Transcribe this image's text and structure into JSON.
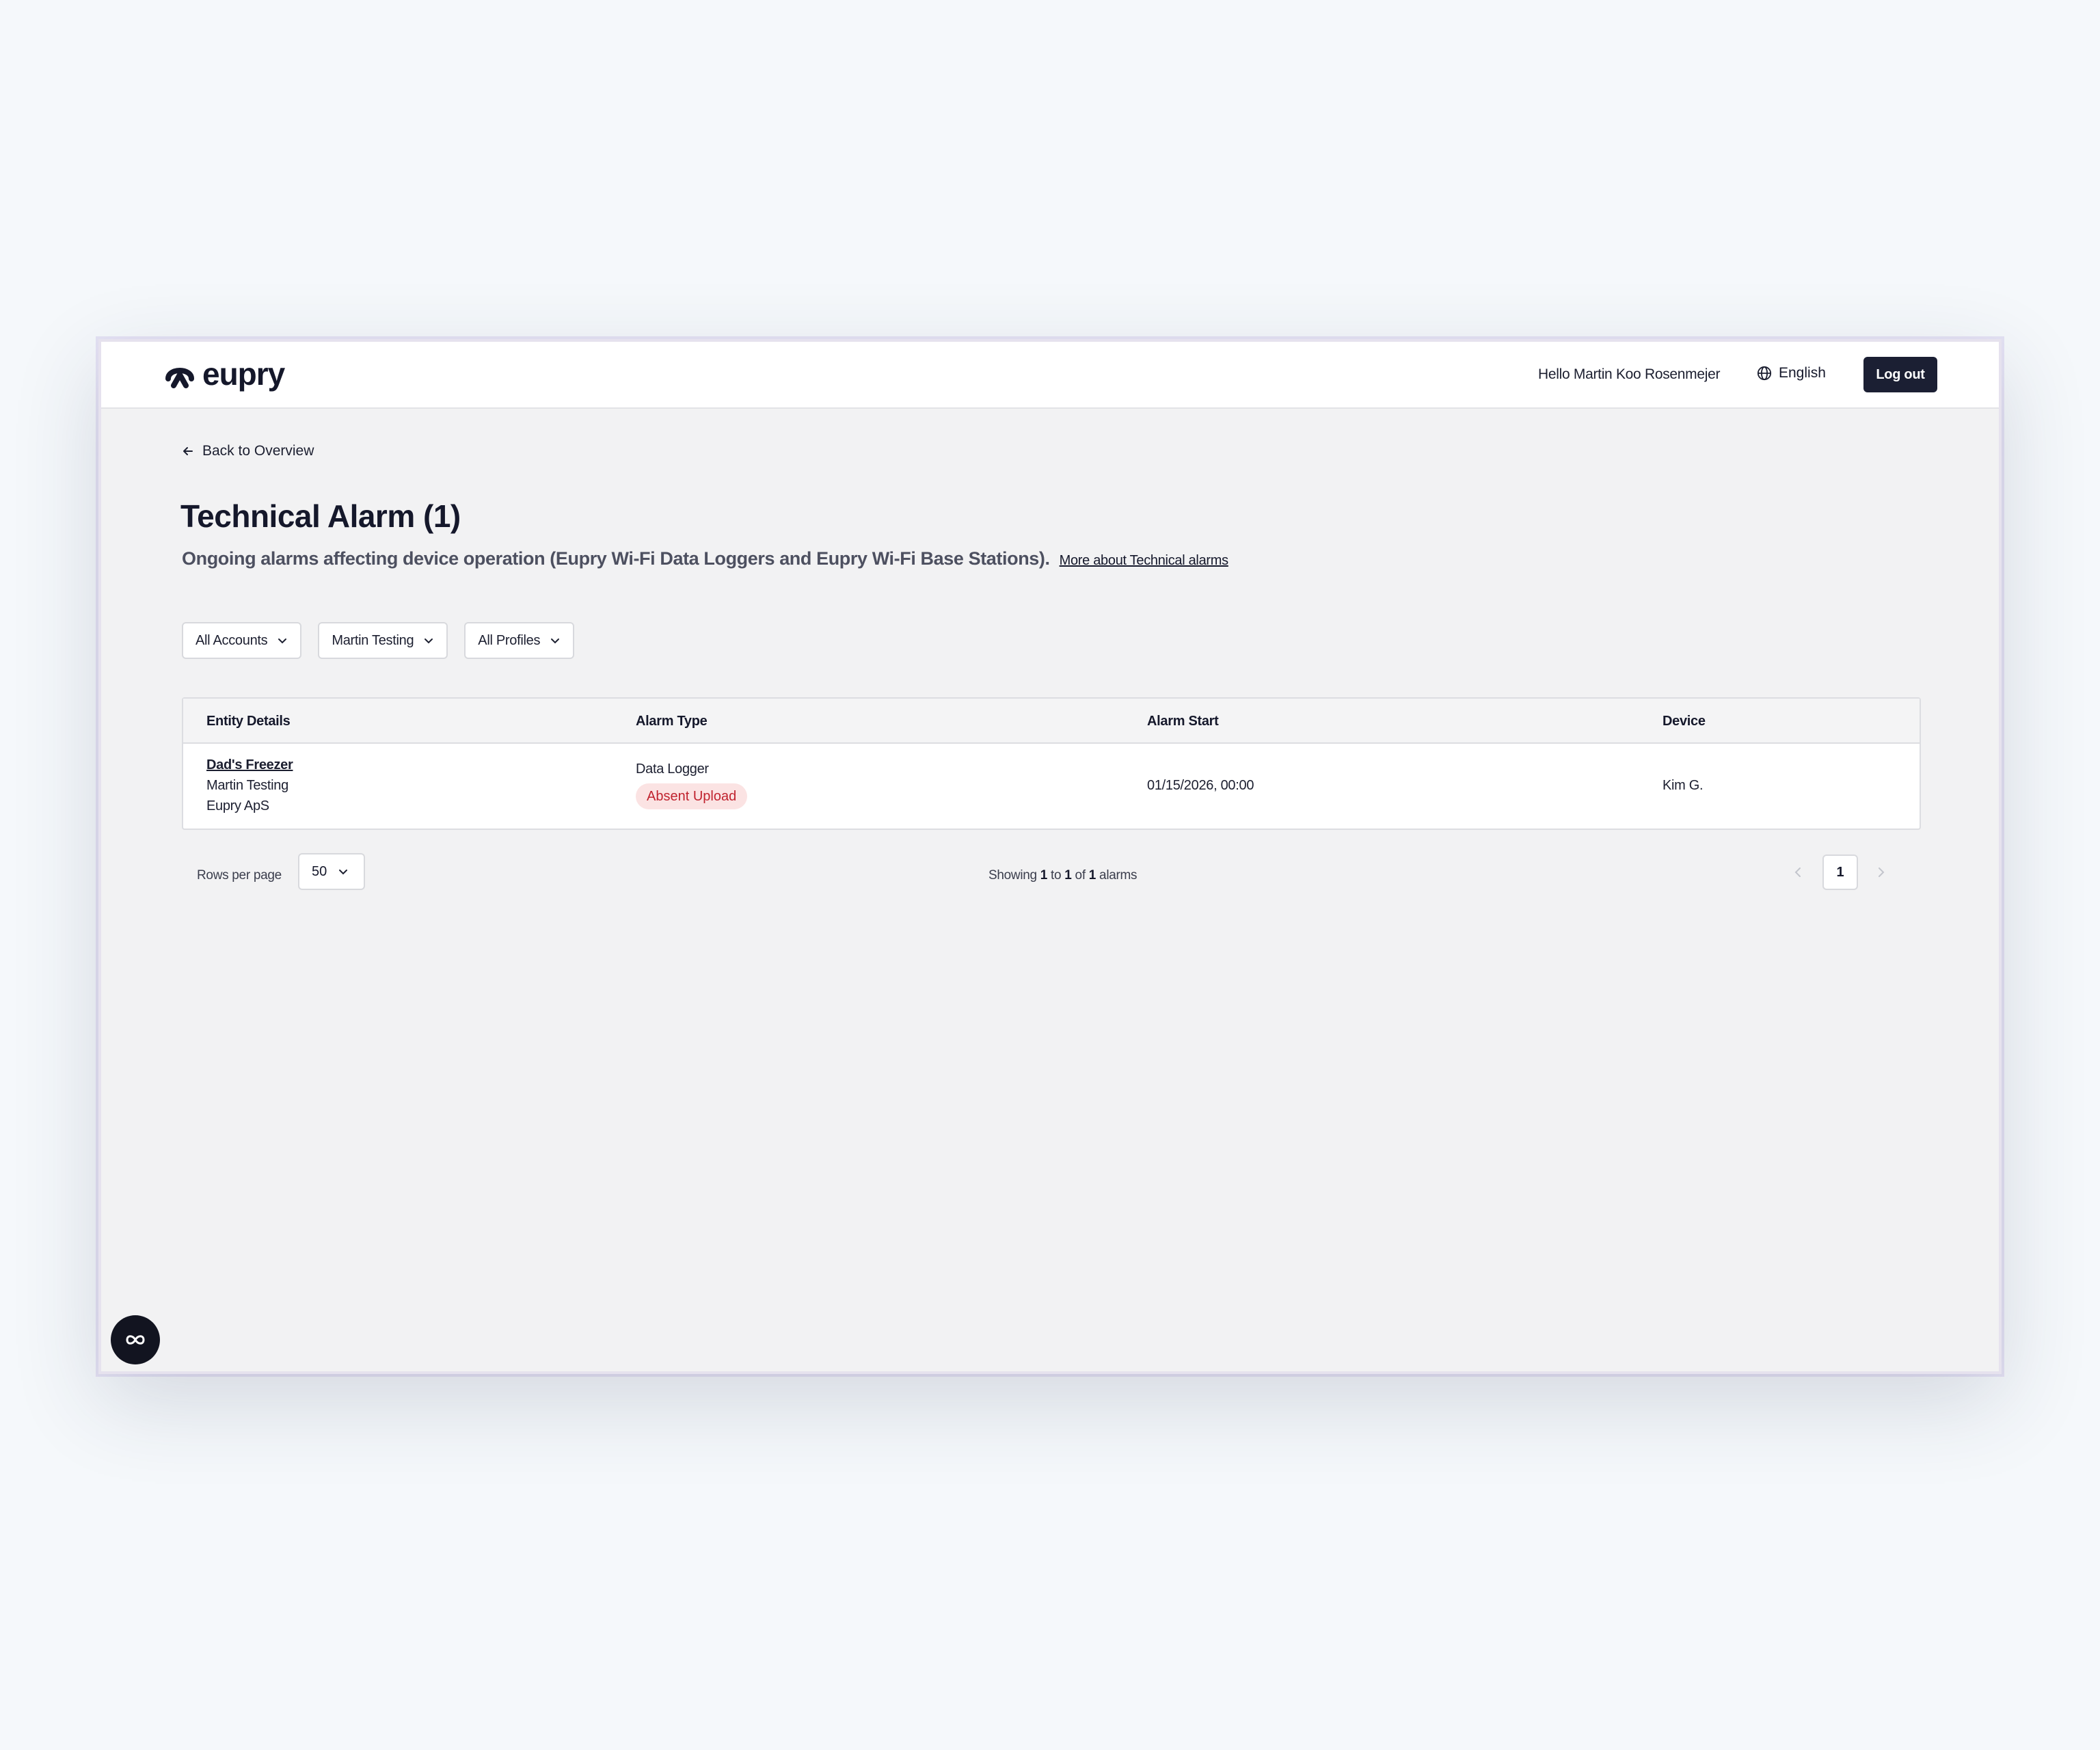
{
  "header": {
    "logo_text": "eupry",
    "greeting": "Hello Martin Koo Rosenmejer",
    "language": "English",
    "logout_label": "Log out"
  },
  "nav": {
    "back_label": "Back to Overview"
  },
  "page": {
    "title": "Technical Alarm (1)",
    "subtitle": "Ongoing alarms affecting device operation (Eupry Wi-Fi Data Loggers and Eupry Wi-Fi Base Stations).",
    "more_link": "More about Technical alarms"
  },
  "filters": {
    "accounts": "All Accounts",
    "location": "Martin Testing",
    "profiles": "All Profiles"
  },
  "table": {
    "columns": [
      "Entity Details",
      "Alarm Type",
      "Alarm Start",
      "Device"
    ],
    "rows": [
      {
        "entity_name": "Dad's Freezer",
        "entity_location": "Martin Testing",
        "entity_company": "Eupry ApS",
        "alarm_type": "Data Logger",
        "alarm_badge": "Absent Upload",
        "alarm_start": "01/15/2026, 00:00",
        "device": "Kim G."
      }
    ]
  },
  "pagination": {
    "rows_per_page_label": "Rows per page",
    "rows_per_page_value": "50",
    "showing_prefix": "Showing",
    "from": "1",
    "to_word": "to",
    "to": "1",
    "of_word": "of",
    "total": "1",
    "suffix": "alarms",
    "current_page": "1"
  },
  "icons": {
    "logo": "eupry-logo-icon",
    "globe": "globe-icon",
    "back": "arrow-left-icon",
    "dropdown": "chevron-down-icon",
    "prev": "chevron-left-icon",
    "next": "chevron-right-icon",
    "fab": "infinity-chat-icon"
  },
  "colors": {
    "primary_dark": "#1b1f33",
    "badge_bg": "#fbe3e3",
    "badge_text": "#c0222e",
    "page_bg": "#f2f2f3"
  }
}
